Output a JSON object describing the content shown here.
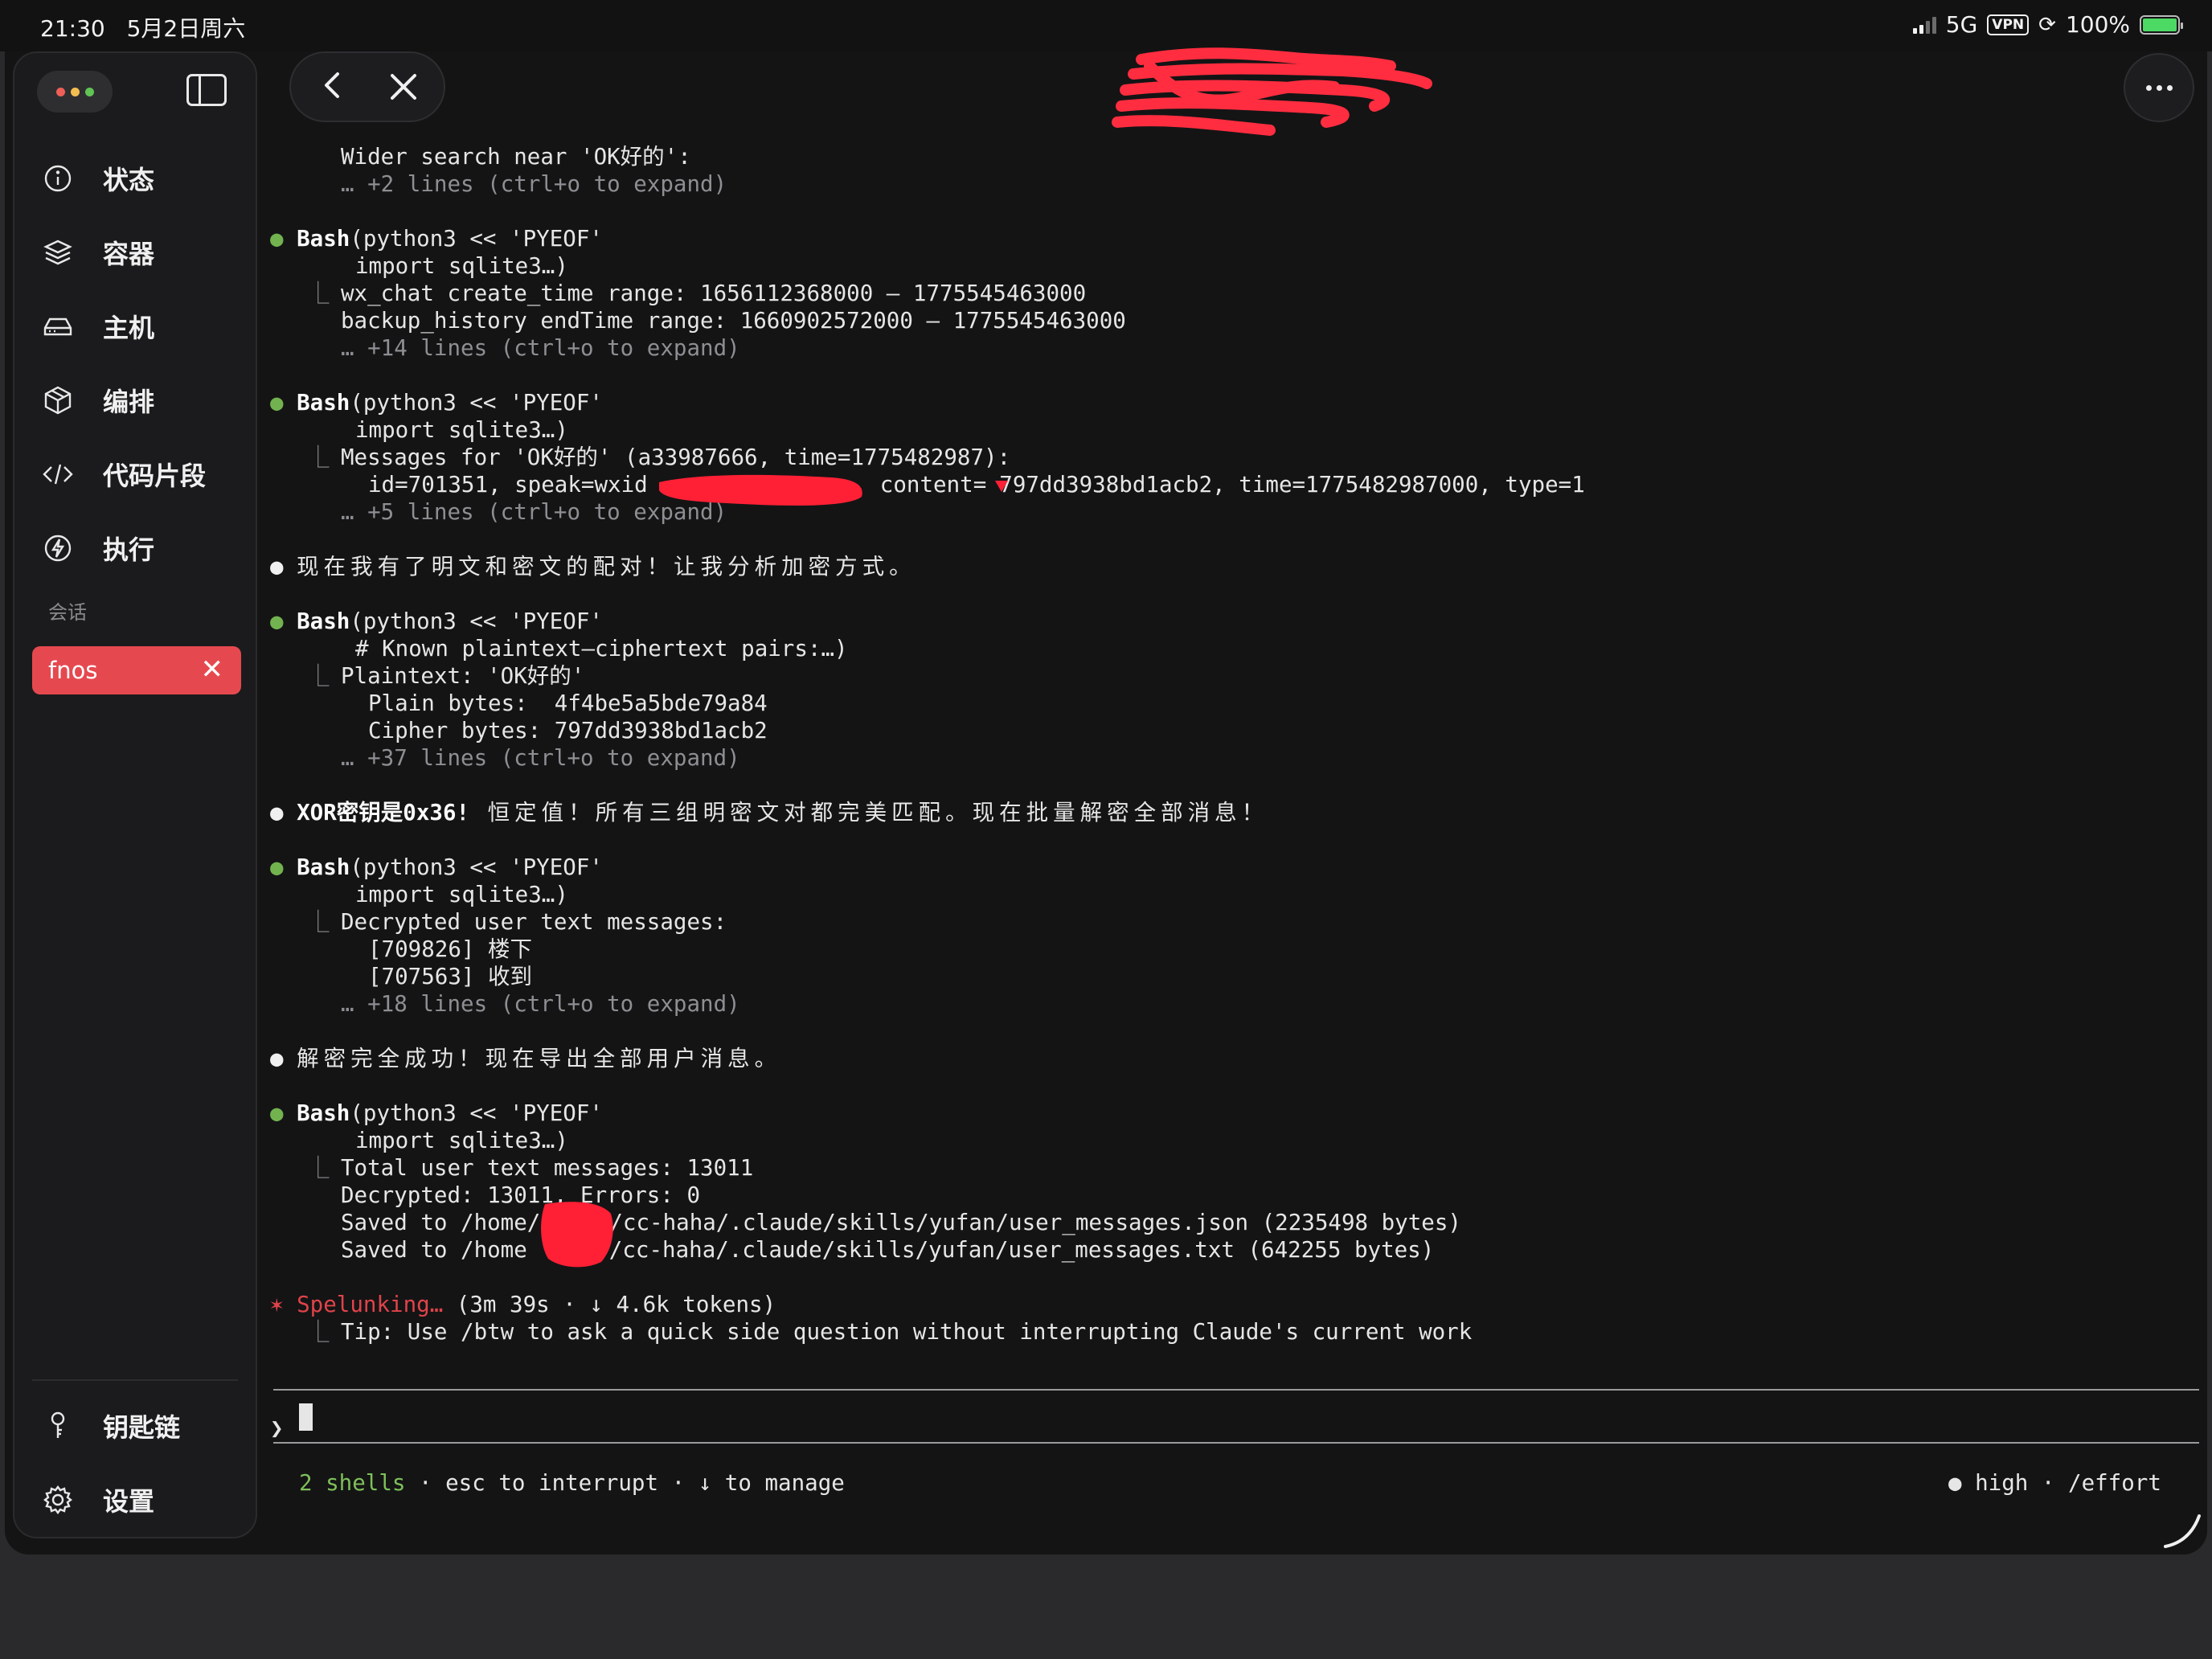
{
  "status_bar": {
    "time": "21:30",
    "date": "5月2日周六",
    "network": "5G",
    "vpn": "VPN",
    "battery": "100%"
  },
  "sidebar": {
    "nav_items": [
      {
        "label": "状态",
        "icon": "info-icon"
      },
      {
        "label": "容器",
        "icon": "layers-icon"
      },
      {
        "label": "主机",
        "icon": "hard-drive-icon"
      },
      {
        "label": "编排",
        "icon": "box-icon"
      },
      {
        "label": "代码片段",
        "icon": "code-icon"
      },
      {
        "label": "执行",
        "icon": "bolt-icon"
      }
    ],
    "section_label": "会话",
    "session": {
      "label": "fnos",
      "close": "✕"
    },
    "bottom_items": [
      {
        "label": "钥匙链",
        "icon": "key-icon"
      },
      {
        "label": "设置",
        "icon": "gear-icon"
      }
    ]
  },
  "colors": {
    "accent_red": "#e5494f",
    "bullet_green": "#72b34f",
    "background": "#141415"
  },
  "terminal": {
    "blocks": {
      "wider_search": "Wider search near 'OK好的':",
      "wider_more": "… +2 lines (ctrl+o to expand)",
      "b1_cmd_name": "Bash",
      "b1_cmd_args": "(python3 << 'PYEOF'",
      "b1_cmd_cont": "import sqlite3…)",
      "b1_out1": "wx_chat create_time range: 1656112368000 – 1775545463000",
      "b1_out2": "backup_history endTime range: 1660902572000 – 1775545463000",
      "b1_more": "… +14 lines (ctrl+o to expand)",
      "b2_cmd_name": "Bash",
      "b2_cmd_args": "(python3 << 'PYEOF'",
      "b2_cmd_cont": "import sqlite3…)",
      "b2_out1": "Messages for 'OK好的' (a33987666, time=1775482987):",
      "b2_out2a": "id=701351, speak=wxid",
      "b2_out2b": ", content=",
      "b2_out2c": "797dd3938bd1acb2, time=1775482987000, type=1",
      "b2_more": "… +5 lines (ctrl+o to expand)",
      "msg1": "现在我有了明文和密文的配对！让我分析加密方式。",
      "b3_cmd_name": "Bash",
      "b3_cmd_args": "(python3 << 'PYEOF'",
      "b3_cmd_cont": "# Known plaintext–ciphertext pairs:…)",
      "b3_out1": "Plaintext: 'OK好的'",
      "b3_out2": "Plain bytes:  4f4be5a5bde79a84",
      "b3_out3": "Cipher bytes: 797dd3938bd1acb2",
      "b3_more": "… +37 lines (ctrl+o to expand)",
      "msg2_bold": "XOR密钥是0x36!",
      "msg2_rest": " 恒定值！所有三组明密文对都完美匹配。现在批量解密全部消息！",
      "b4_cmd_name": "Bash",
      "b4_cmd_args": "(python3 << 'PYEOF'",
      "b4_cmd_cont": "import sqlite3…)",
      "b4_out1": "Decrypted user text messages:",
      "b4_out2": "[709826] 楼下",
      "b4_out3": "[707563] 收到",
      "b4_more": "… +18 lines (ctrl+o to expand)",
      "msg3": "解密完全成功！现在导出全部用户消息。",
      "b5_cmd_name": "Bash",
      "b5_cmd_args": "(python3 << 'PYEOF'",
      "b5_cmd_cont": "import sqlite3…)",
      "b5_out1": "Total user text messages: 13011",
      "b5_out2": "Decrypted: 13011, Errors: 0",
      "b5_out3a": "Saved to /home/",
      "b5_out3b": "/cc-haha/.claude/skills/yufan/user_messages.json (2235498 bytes)",
      "b5_out4a": "Saved to /home",
      "b5_out4b": "/cc-haha/.claude/skills/yufan/user_messages.txt (642255 bytes)",
      "spinner_word": "Spelunking…",
      "spinner_stats": " (3m 39s · ↓ 4.6k tokens)",
      "tip": "Tip: Use /btw to ask a quick side question without interrupting Claude's current work"
    },
    "prompt_symbol": "❯",
    "footer_shells": "2 shells",
    "footer_hints": " · esc to interrupt · ↓ to manage",
    "footer_right": "● high · /effort"
  }
}
